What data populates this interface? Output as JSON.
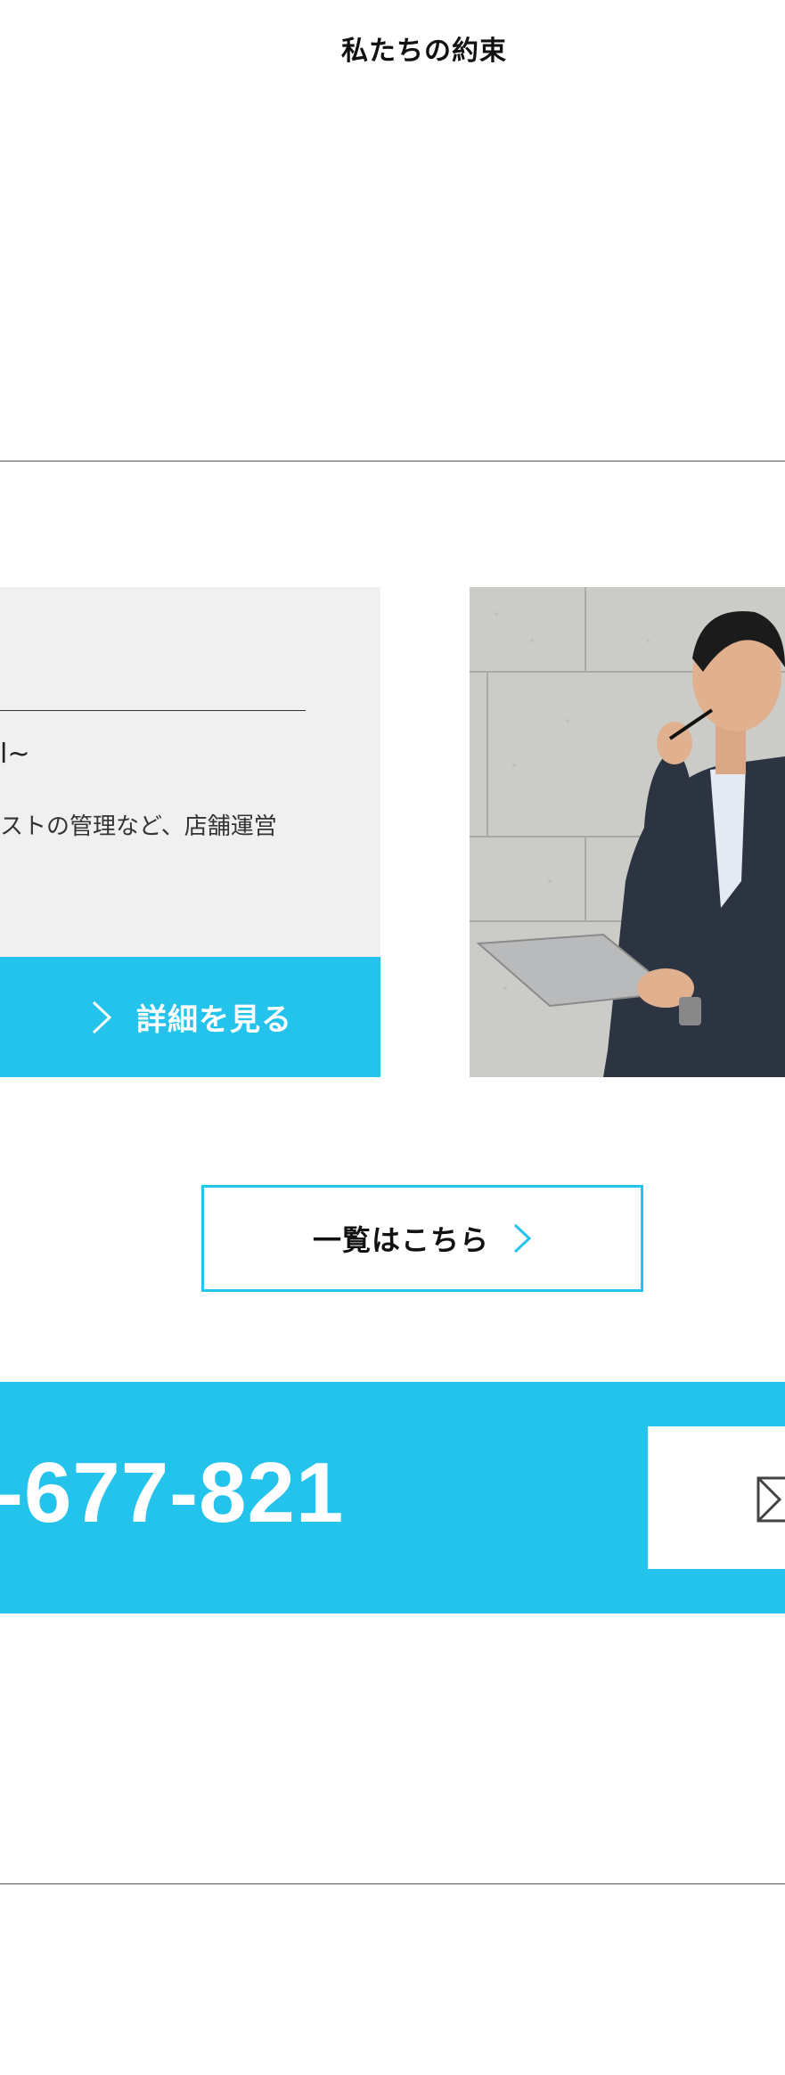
{
  "nav": {
    "promise_link": "私たちの約束"
  },
  "service_card": {
    "title_fragment": "l~",
    "description_fragment": "ストの管理など、店舗運営",
    "detail_button_label": "詳細を見る"
  },
  "photo": {
    "alt": "クリップボードとペンを持つスーツ姿の男性"
  },
  "list_button": {
    "label": "一覧はこちら"
  },
  "contact": {
    "phone_fragment": "-677-821"
  },
  "colors": {
    "accent": "#24c3ec",
    "card_bg": "#f0f0f0",
    "text": "#1a1a1a"
  },
  "icons": {
    "detail_chevron": "chevron-right-icon",
    "list_chevron": "chevron-right-icon",
    "mail": "mail-icon"
  }
}
